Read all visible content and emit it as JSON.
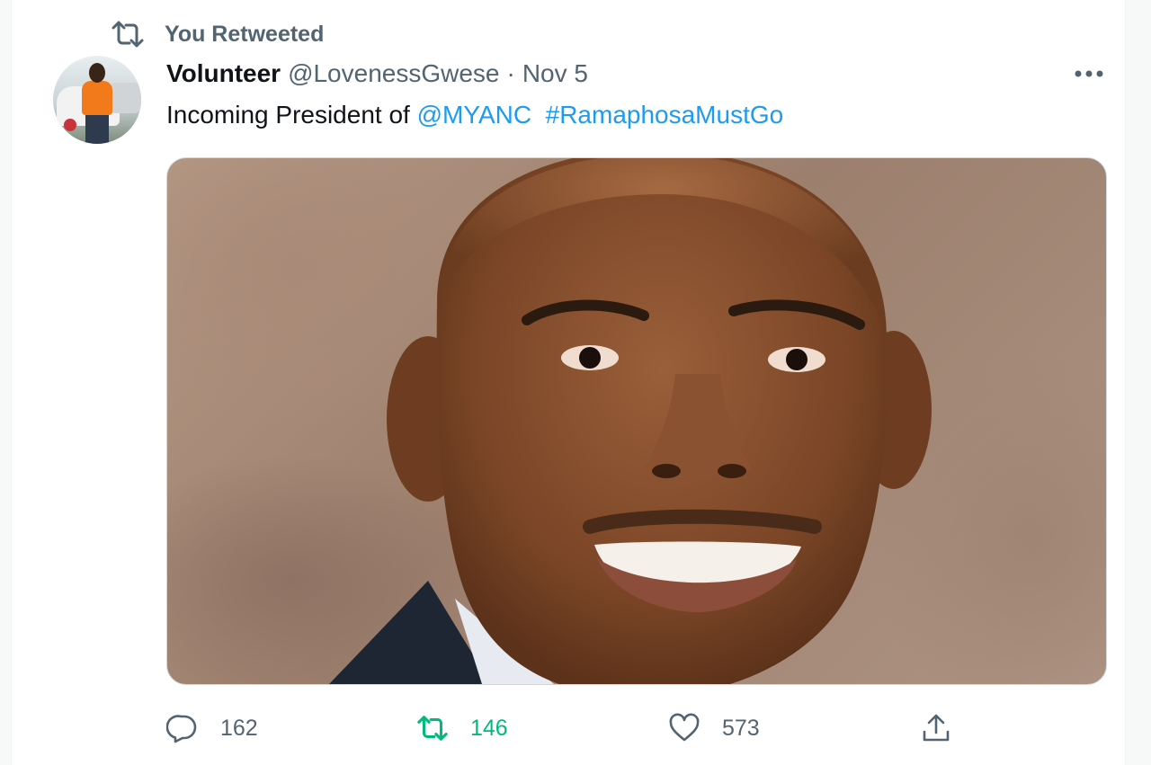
{
  "social_context": {
    "label": "You Retweeted"
  },
  "tweet": {
    "display_name": "Volunteer",
    "handle": "@LovenessGwese",
    "separator": "·",
    "date": "Nov 5",
    "text_prefix": "Incoming President of ",
    "mention": "@MYANC",
    "hashtag": "#RamaphosaMustGo",
    "avatar_icon": "user-avatar-photo",
    "media_icon": "portrait-photo"
  },
  "actions": {
    "reply_count": "162",
    "retweet_count": "146",
    "like_count": "573"
  },
  "colors": {
    "link": "#1d9bf0",
    "retweet_active": "#00ba7c",
    "secondary_text": "#536471"
  }
}
